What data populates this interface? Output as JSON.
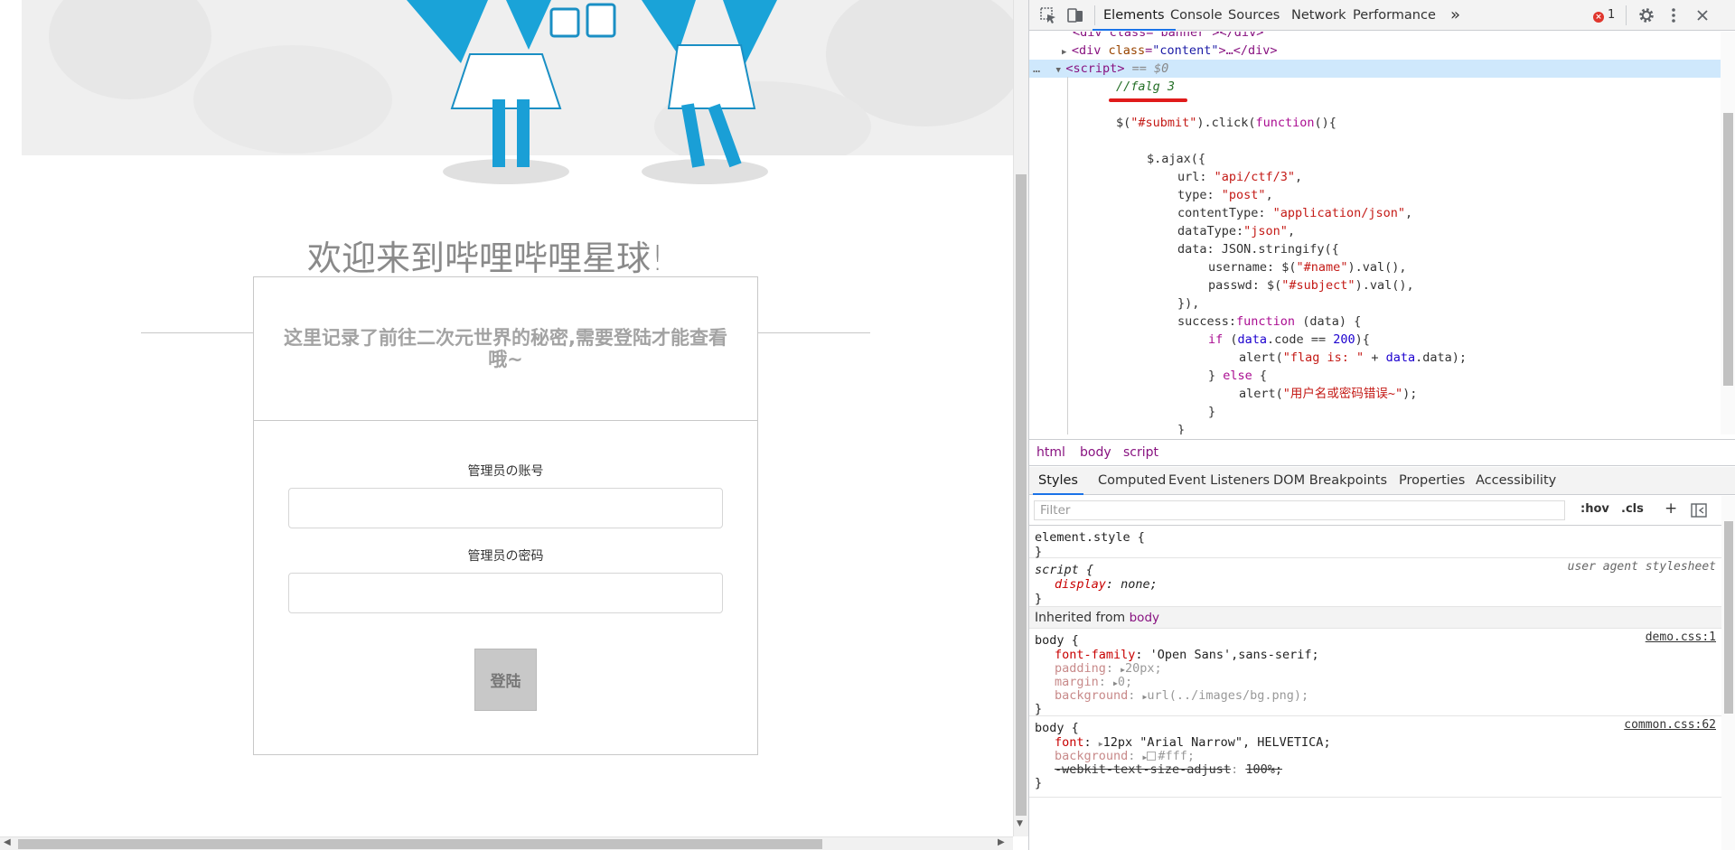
{
  "page": {
    "welcome": "欢迎来到哔哩哔哩星球!",
    "intro": "这里记录了前往二次元世界的秘密,需要登陆才能查看哦~",
    "username_label": "管理员の账号",
    "password_label": "管理员の密码",
    "login_button": "登陆"
  },
  "devtools": {
    "tabs": [
      "Elements",
      "Console",
      "Sources",
      "Network",
      "Performance"
    ],
    "active_tab": "Elements",
    "more_tabs": "»",
    "error_count": "1",
    "icons": [
      "inspect-icon",
      "device-toolbar-icon",
      "settings-icon",
      "kebab-menu-icon"
    ],
    "code": [
      {
        "type": "partial",
        "text": "<div class=\"banner\"></div>"
      },
      {
        "type": "div",
        "tag": "div",
        "attr": "class",
        "val": "\"content\"",
        "rest": "…</div>"
      },
      {
        "type": "script",
        "tag": "script",
        "suffix": " == $0"
      },
      {
        "type": "comment",
        "text": "//falg 3"
      },
      {
        "type": "blank"
      },
      {
        "type": "js",
        "indent": 0,
        "parts": [
          [
            "p",
            "$("
          ],
          [
            "s",
            "\"#submit\""
          ],
          [
            "p",
            ").click("
          ],
          [
            "k",
            "function"
          ],
          [
            "p",
            "(){"
          ]
        ]
      },
      {
        "type": "blank"
      },
      {
        "type": "js",
        "indent": 1,
        "parts": [
          [
            "p",
            "$.ajax({"
          ]
        ]
      },
      {
        "type": "js",
        "indent": 2,
        "parts": [
          [
            "p",
            "url: "
          ],
          [
            "s",
            "\"api/ctf/3\""
          ],
          [
            "p",
            ","
          ]
        ]
      },
      {
        "type": "js",
        "indent": 2,
        "parts": [
          [
            "p",
            "type: "
          ],
          [
            "s",
            "\"post\""
          ],
          [
            "p",
            ","
          ]
        ]
      },
      {
        "type": "js",
        "indent": 2,
        "parts": [
          [
            "p",
            "contentType: "
          ],
          [
            "s",
            "\"application/json\""
          ],
          [
            "p",
            ","
          ]
        ]
      },
      {
        "type": "js",
        "indent": 2,
        "parts": [
          [
            "p",
            "dataType:"
          ],
          [
            "s",
            "\"json\""
          ],
          [
            "p",
            ","
          ]
        ]
      },
      {
        "type": "js",
        "indent": 2,
        "parts": [
          [
            "p",
            "data: JSON.stringify({"
          ]
        ]
      },
      {
        "type": "js",
        "indent": 3,
        "parts": [
          [
            "p",
            "username: $("
          ],
          [
            "s",
            "\"#name\""
          ],
          [
            "p",
            ").val(),"
          ]
        ]
      },
      {
        "type": "js",
        "indent": 3,
        "parts": [
          [
            "p",
            "passwd: $("
          ],
          [
            "s",
            "\"#subject\""
          ],
          [
            "p",
            ").val(),"
          ]
        ]
      },
      {
        "type": "js",
        "indent": 2,
        "parts": [
          [
            "p",
            "}),"
          ]
        ]
      },
      {
        "type": "js",
        "indent": 2,
        "parts": [
          [
            "p",
            "success:"
          ],
          [
            "k",
            "function"
          ],
          [
            "p",
            " (data) {"
          ]
        ]
      },
      {
        "type": "js",
        "indent": 3,
        "parts": [
          [
            "k",
            "if"
          ],
          [
            "p",
            " ("
          ],
          [
            "v",
            "data"
          ],
          [
            "p",
            ".code == "
          ],
          [
            "n",
            "200"
          ],
          [
            "p",
            "){"
          ]
        ]
      },
      {
        "type": "js",
        "indent": 4,
        "parts": [
          [
            "p",
            "alert("
          ],
          [
            "s",
            "\"flag is: \""
          ],
          [
            "p",
            " + "
          ],
          [
            "v",
            "data"
          ],
          [
            "p",
            ".data);"
          ]
        ]
      },
      {
        "type": "js",
        "indent": 3,
        "parts": [
          [
            "p",
            "} "
          ],
          [
            "k",
            "else"
          ],
          [
            "p",
            " {"
          ]
        ]
      },
      {
        "type": "js",
        "indent": 4,
        "parts": [
          [
            "p",
            "alert("
          ],
          [
            "s",
            "\"用户名或密码错误~\""
          ],
          [
            "p",
            ");"
          ]
        ]
      },
      {
        "type": "js",
        "indent": 3,
        "parts": [
          [
            "p",
            "}"
          ]
        ]
      },
      {
        "type": "js",
        "indent": 2,
        "parts": [
          [
            "p",
            "}"
          ]
        ]
      }
    ],
    "breadcrumbs": [
      "html",
      "body",
      "script"
    ],
    "style_tabs": [
      "Styles",
      "Computed",
      "Event Listeners",
      "DOM Breakpoints",
      "Properties",
      "Accessibility"
    ],
    "active_style_tab": "Styles",
    "filter_placeholder": "Filter",
    "filter_hov": ":hov",
    "filter_cls": ".cls",
    "filter_add": "+",
    "rules": {
      "element_style": "element.style {",
      "script_selector": "script {",
      "script_source": "user agent stylesheet",
      "script_prop": "display",
      "script_val": "none;",
      "inherited_label": "Inherited from",
      "inherited_tag": "body",
      "body1_source": "demo.css:1",
      "body1_props": [
        {
          "name": "font-family",
          "val": "'Open Sans',sans-serif;",
          "off": false,
          "arrow": false
        },
        {
          "name": "padding",
          "val": "20px;",
          "off": true,
          "arrow": true
        },
        {
          "name": "margin",
          "val": "0;",
          "off": true,
          "arrow": true
        },
        {
          "name": "background",
          "val": "url(../images/bg.png);",
          "off": true,
          "arrow": true
        }
      ],
      "body2_source": "common.css:62",
      "body2_props": [
        {
          "name": "font",
          "val": "12px \"Arial Narrow\", HELVETICA;",
          "off": false,
          "arrow": true
        },
        {
          "name": "background",
          "val": "#fff;",
          "off": true,
          "arrow": true
        },
        {
          "name": "-webkit-text-size-adjust",
          "val": "100%;",
          "off": true,
          "strike": true
        }
      ],
      "body_selector": "body {",
      "close": "}"
    }
  }
}
